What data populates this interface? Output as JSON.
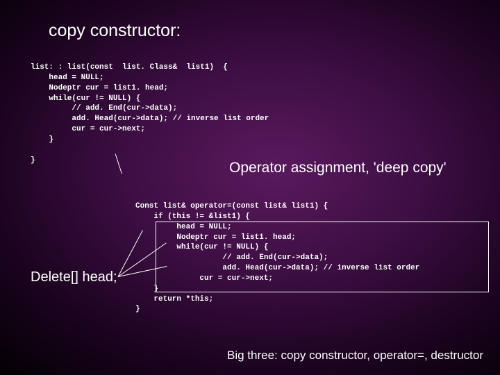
{
  "title": "copy constructor:",
  "code1": "list: : list(const  list. Class&  list1)  {\n    head = NULL;\n    Nodeptr cur = list1. head;\n    while(cur != NULL) {\n         // add. End(cur->data);\n         add. Head(cur->data); // inverse list order\n         cur = cur->next;\n    }\n\n}",
  "subheading": "Operator assignment, 'deep copy'",
  "code2": "Const list& operator=(const list& list1) {\n    if (this != &list1) {\n         head = NULL;\n         Nodeptr cur = list1. head;\n         while(cur != NULL) {\n                   // add. End(cur->data);\n                   add. Head(cur->data); // inverse list order\n              cur = cur->next;\n    }\n    return *this;\n}",
  "delete_label": "Delete[] head;",
  "footer": "Big three: copy constructor, operator=, destructor"
}
